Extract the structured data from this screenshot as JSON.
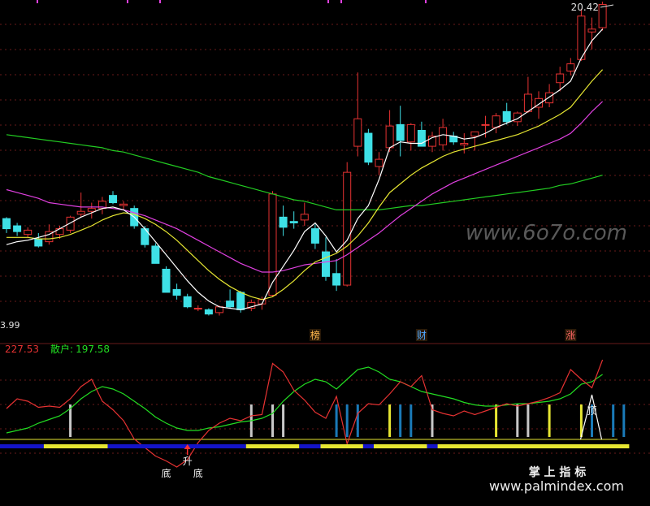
{
  "chart_data": [
    {
      "type": "candlestick",
      "price_high_label": "20.42",
      "price_low_label": "3.99",
      "watermark": "www.6o7o.com",
      "colors": {
        "up": "#e63232",
        "down": "#3ee0e6",
        "ma5": "#ffffff",
        "ma10": "#e6e632",
        "ma30": "#e040e0",
        "ma60": "#22cc22",
        "background": "#000000",
        "grid": "#6a1a1a"
      },
      "events": [
        {
          "index": 29,
          "label": "榜"
        },
        {
          "index": 39,
          "label": "财"
        },
        {
          "index": 53,
          "label": "涨"
        }
      ],
      "ohlc": [
        [
          6.9,
          7.0,
          5.9,
          6.2
        ],
        [
          6.4,
          6.6,
          5.7,
          6.0
        ],
        [
          5.8,
          6.3,
          5.6,
          6.1
        ],
        [
          5.5,
          5.9,
          4.9,
          5.0
        ],
        [
          5.3,
          6.5,
          5.1,
          6.0
        ],
        [
          5.8,
          6.4,
          5.5,
          6.2
        ],
        [
          6.1,
          7.1,
          5.9,
          7.0
        ],
        [
          7.2,
          8.7,
          7.0,
          7.4
        ],
        [
          7.4,
          8.0,
          6.9,
          7.6
        ],
        [
          7.6,
          8.4,
          7.2,
          8.1
        ],
        [
          8.5,
          8.8,
          7.9,
          8.0
        ],
        [
          7.8,
          8.1,
          7.5,
          7.9
        ],
        [
          7.6,
          7.8,
          6.2,
          6.4
        ],
        [
          6.2,
          6.4,
          4.9,
          5.1
        ],
        [
          5.0,
          5.2,
          3.8,
          3.8
        ],
        [
          3.4,
          3.6,
          1.8,
          1.8
        ],
        [
          2.0,
          2.4,
          1.3,
          1.6
        ],
        [
          1.5,
          1.7,
          0.7,
          0.8
        ],
        [
          0.7,
          0.9,
          0.5,
          0.7
        ],
        [
          0.6,
          0.7,
          0.2,
          0.3
        ],
        [
          0.4,
          0.9,
          0.2,
          0.8
        ],
        [
          1.2,
          2.0,
          0.7,
          0.8
        ],
        [
          1.8,
          1.9,
          0.4,
          0.6
        ],
        [
          0.7,
          1.3,
          0.5,
          1.1
        ],
        [
          1.0,
          1.5,
          0.6,
          1.3
        ],
        [
          1.6,
          8.8,
          1.5,
          8.6
        ],
        [
          7.0,
          7.8,
          5.7,
          6.3
        ],
        [
          6.7,
          7.4,
          6.2,
          6.6
        ],
        [
          6.8,
          8.0,
          6.4,
          7.2
        ],
        [
          6.2,
          6.5,
          4.8,
          5.2
        ],
        [
          4.6,
          5.6,
          2.6,
          2.9
        ],
        [
          3.1,
          4.1,
          1.9,
          2.3
        ],
        [
          2.3,
          10.8,
          2.2,
          10.1
        ],
        [
          11.9,
          17.0,
          11.2,
          13.8
        ],
        [
          12.8,
          13.1,
          10.6,
          10.8
        ],
        [
          10.5,
          11.5,
          9.9,
          11.0
        ],
        [
          11.8,
          14.4,
          11.5,
          13.3
        ],
        [
          13.4,
          14.7,
          11.2,
          12.3
        ],
        [
          12.2,
          13.5,
          11.6,
          13.4
        ],
        [
          13.0,
          13.6,
          11.9,
          11.9
        ],
        [
          11.9,
          12.9,
          11.5,
          12.6
        ],
        [
          12.0,
          13.8,
          11.6,
          13.2
        ],
        [
          12.6,
          12.9,
          12.0,
          12.2
        ],
        [
          12.0,
          12.8,
          11.4,
          12.1
        ],
        [
          12.6,
          12.9,
          11.6,
          12.9
        ],
        [
          13.4,
          14.0,
          12.5,
          13.4
        ],
        [
          13.2,
          14.2,
          12.8,
          14.0
        ],
        [
          14.3,
          14.9,
          13.4,
          13.6
        ],
        [
          13.6,
          14.3,
          13.3,
          14.2
        ],
        [
          14.3,
          16.7,
          14.2,
          15.5
        ],
        [
          14.6,
          15.7,
          13.8,
          15.2
        ],
        [
          14.9,
          16.2,
          14.6,
          15.6
        ],
        [
          16.3,
          17.4,
          15.7,
          16.9
        ],
        [
          17.1,
          18.0,
          16.8,
          17.6
        ],
        [
          17.9,
          21.4,
          17.8,
          20.9
        ],
        [
          19.8,
          20.8,
          18.6,
          20.0
        ],
        [
          20.1,
          21.9,
          19.9,
          21.7
        ]
      ],
      "ma5": [
        5.1,
        5.3,
        5.4,
        5.6,
        5.8,
        6.2,
        6.6,
        7.0,
        7.3,
        7.6,
        7.7,
        7.5,
        7.0,
        6.2,
        5.3,
        4.4,
        3.5,
        2.6,
        1.8,
        1.2,
        0.8,
        0.7,
        0.6,
        0.8,
        1.0,
        2.5,
        3.6,
        4.7,
        6.0,
        6.6,
        5.7,
        4.6,
        5.4,
        6.9,
        7.8,
        9.6,
        11.8,
        12.2,
        12.1,
        12.1,
        12.5,
        12.7,
        12.6,
        12.4,
        12.5,
        12.8,
        13.2,
        13.5,
        13.8,
        14.3,
        14.8,
        15.3,
        15.8,
        16.4,
        18.0,
        19.2,
        20.0
      ],
      "ma10": [
        5.6,
        5.6,
        5.6,
        5.5,
        5.5,
        5.6,
        5.8,
        6.1,
        6.4,
        6.8,
        7.1,
        7.3,
        7.2,
        6.9,
        6.5,
        6.0,
        5.4,
        4.7,
        4.0,
        3.3,
        2.7,
        2.2,
        1.8,
        1.5,
        1.3,
        1.5,
        2.0,
        2.6,
        3.3,
        3.9,
        4.2,
        4.5,
        5.0,
        5.7,
        6.6,
        7.7,
        8.7,
        9.3,
        9.9,
        10.4,
        10.8,
        11.2,
        11.5,
        11.7,
        11.9,
        12.1,
        12.3,
        12.5,
        12.7,
        13.0,
        13.3,
        13.7,
        14.1,
        14.6,
        15.5,
        16.4,
        17.2
      ],
      "ma30": [
        8.9,
        8.7,
        8.5,
        8.3,
        8.0,
        7.9,
        7.8,
        7.7,
        7.7,
        7.7,
        7.6,
        7.5,
        7.3,
        7.1,
        6.8,
        6.5,
        6.2,
        5.8,
        5.4,
        5.0,
        4.6,
        4.2,
        3.8,
        3.5,
        3.2,
        3.2,
        3.3,
        3.5,
        3.7,
        3.8,
        3.9,
        4.0,
        4.4,
        4.9,
        5.4,
        5.9,
        6.5,
        7.1,
        7.6,
        8.1,
        8.6,
        9.0,
        9.4,
        9.7,
        10.0,
        10.3,
        10.6,
        10.9,
        11.2,
        11.5,
        11.8,
        12.1,
        12.4,
        12.8,
        13.5,
        14.3,
        15.0
      ],
      "ma60": [
        12.7,
        12.6,
        12.5,
        12.4,
        12.3,
        12.2,
        12.1,
        12.0,
        11.9,
        11.8,
        11.6,
        11.5,
        11.3,
        11.1,
        10.9,
        10.7,
        10.5,
        10.3,
        10.1,
        9.8,
        9.6,
        9.4,
        9.2,
        9.0,
        8.8,
        8.6,
        8.4,
        8.2,
        8.1,
        7.9,
        7.7,
        7.5,
        7.5,
        7.5,
        7.5,
        7.5,
        7.6,
        7.7,
        7.8,
        7.8,
        7.9,
        8.0,
        8.1,
        8.2,
        8.3,
        8.4,
        8.5,
        8.6,
        8.7,
        8.8,
        8.9,
        9.0,
        9.2,
        9.3,
        9.5,
        9.7,
        9.9
      ]
    },
    {
      "type": "line",
      "series": [
        {
          "name": "散户",
          "value_label": "197.58",
          "color": "#22dd22"
        },
        {
          "value_label": "227.53",
          "color": "#e63232"
        }
      ],
      "separator": ":",
      "red": [
        58,
        66,
        64,
        59,
        60,
        59,
        66,
        76,
        82,
        64,
        57,
        48,
        33,
        26,
        19,
        15,
        10,
        16,
        30,
        40,
        46,
        50,
        48,
        52,
        53,
        95,
        88,
        73,
        65,
        55,
        50,
        68,
        29,
        54,
        62,
        61,
        70,
        80,
        76,
        85,
        57,
        54,
        52,
        56,
        53,
        56,
        59,
        62,
        60,
        62,
        64,
        67,
        71,
        90,
        82,
        75,
        98
      ],
      "green": [
        38,
        40,
        42,
        46,
        49,
        52,
        58,
        66,
        72,
        76,
        74,
        70,
        64,
        58,
        51,
        46,
        42,
        40,
        40,
        42,
        43,
        45,
        47,
        48,
        50,
        54,
        64,
        72,
        78,
        82,
        80,
        74,
        82,
        90,
        92,
        88,
        82,
        80,
        76,
        72,
        70,
        68,
        66,
        63,
        61,
        60,
        60,
        61,
        62,
        62,
        63,
        64,
        66,
        70,
        78,
        80,
        86
      ],
      "markers": [
        {
          "index": 15,
          "label": "底"
        },
        {
          "index": 18,
          "label": "底"
        },
        {
          "index": 17,
          "label": "升"
        },
        {
          "index": 55,
          "label": "顶"
        }
      ],
      "bars": [
        {
          "index": 6,
          "color": "#c8c8c8"
        },
        {
          "index": 23,
          "color": "#c8c8c8"
        },
        {
          "index": 25,
          "color": "#c8c8c8"
        },
        {
          "index": 26,
          "color": "#c8c8c8"
        },
        {
          "index": 31,
          "color": "#1a7ab8"
        },
        {
          "index": 32,
          "color": "#1a7ab8"
        },
        {
          "index": 33,
          "color": "#1a7ab8"
        },
        {
          "index": 36,
          "color": "#e6e632"
        },
        {
          "index": 37,
          "color": "#1a7ab8"
        },
        {
          "index": 38,
          "color": "#1a7ab8"
        },
        {
          "index": 40,
          "color": "#c8c8c8"
        },
        {
          "index": 46,
          "color": "#e6e632"
        },
        {
          "index": 48,
          "color": "#c8c8c8"
        },
        {
          "index": 49,
          "color": "#c8c8c8"
        },
        {
          "index": 51,
          "color": "#e6e632"
        },
        {
          "index": 54,
          "color": "#e6e632"
        },
        {
          "index": 55,
          "color": "#1a7ab8"
        },
        {
          "index": 57,
          "color": "#1a7ab8"
        },
        {
          "index": 58,
          "color": "#1a7ab8"
        }
      ],
      "band": [
        {
          "from": 0,
          "to": 4,
          "color": "#1414c8"
        },
        {
          "from": 4,
          "to": 10,
          "color": "#e6e632"
        },
        {
          "from": 10,
          "to": 23,
          "color": "#1414c8"
        },
        {
          "from": 23,
          "to": 28,
          "color": "#e6e632"
        },
        {
          "from": 28,
          "to": 30,
          "color": "#1414c8"
        },
        {
          "from": 30,
          "to": 34,
          "color": "#e6e632"
        },
        {
          "from": 34,
          "to": 35,
          "color": "#1414c8"
        },
        {
          "from": 35,
          "to": 40,
          "color": "#e6e632"
        },
        {
          "from": 40,
          "to": 41,
          "color": "#1414c8"
        },
        {
          "from": 41,
          "to": 59,
          "color": "#e6e632"
        }
      ]
    }
  ],
  "footer": {
    "brand": "掌 上 指 标",
    "url": "www.palmindex.com"
  }
}
